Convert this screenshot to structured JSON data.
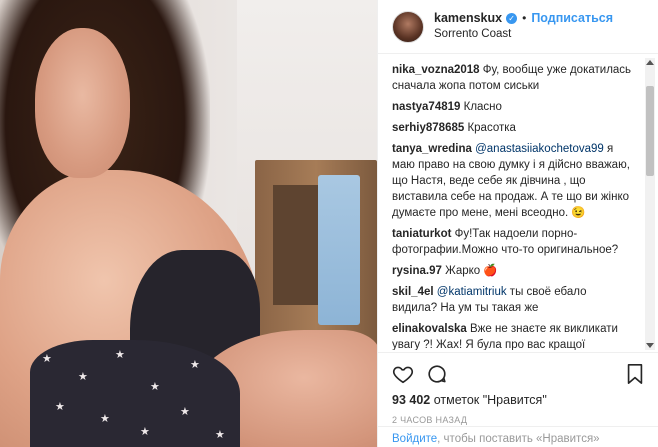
{
  "header": {
    "username": "kamenskux",
    "verified_badge": "✓",
    "separator": "•",
    "follow_label": "Подписаться",
    "location": "Sorrento Coast"
  },
  "photo": {
    "star_glyph": "★"
  },
  "comments": [
    {
      "user": "nika_vozna2018",
      "text": " Фу, вообще уже докатилась сначала жопа потом сиськи"
    },
    {
      "user": "nastya74819",
      "text": " Класно"
    },
    {
      "user": "serhiy878685",
      "text": " Красотка"
    },
    {
      "user": "tanya_wredina",
      "mention": " @anastasiiakochetova99",
      "text": " я маю право на свою думку і я дійсно вважаю, що Настя, веде себе як дівчина , що виставила себе на продаж. А те що ви жінко думаєте про мене, мені всеодно. 😉"
    },
    {
      "user": "taniaturkot",
      "text": " Фу!Так надоели порно-фотографии.Можно что-то оригинальное?"
    },
    {
      "user": "rysina.97",
      "text": " Жарко 🍎"
    },
    {
      "user": "skil_4el",
      "mention": " @katiamitriuk",
      "text": " ты своё ебало видила? На ум ты такая же"
    },
    {
      "user": "elinakovalska",
      "text": " Вже не знаєте як викликати увагу ?! Жах! Я була про вас кращої"
    }
  ],
  "actions": {
    "like_icon": "heart-icon",
    "comment_icon": "comment-icon",
    "save_icon": "bookmark-icon",
    "likes_count": "93 402",
    "likes_text": " отметок \"Нравится\"",
    "time_ago": "2 часов назад"
  },
  "login_bar": {
    "link": "Войдите",
    "text": ", чтобы поставить «Нравится»"
  },
  "colors": {
    "accent": "#3897f0",
    "text": "#262626",
    "muted": "#999999"
  }
}
